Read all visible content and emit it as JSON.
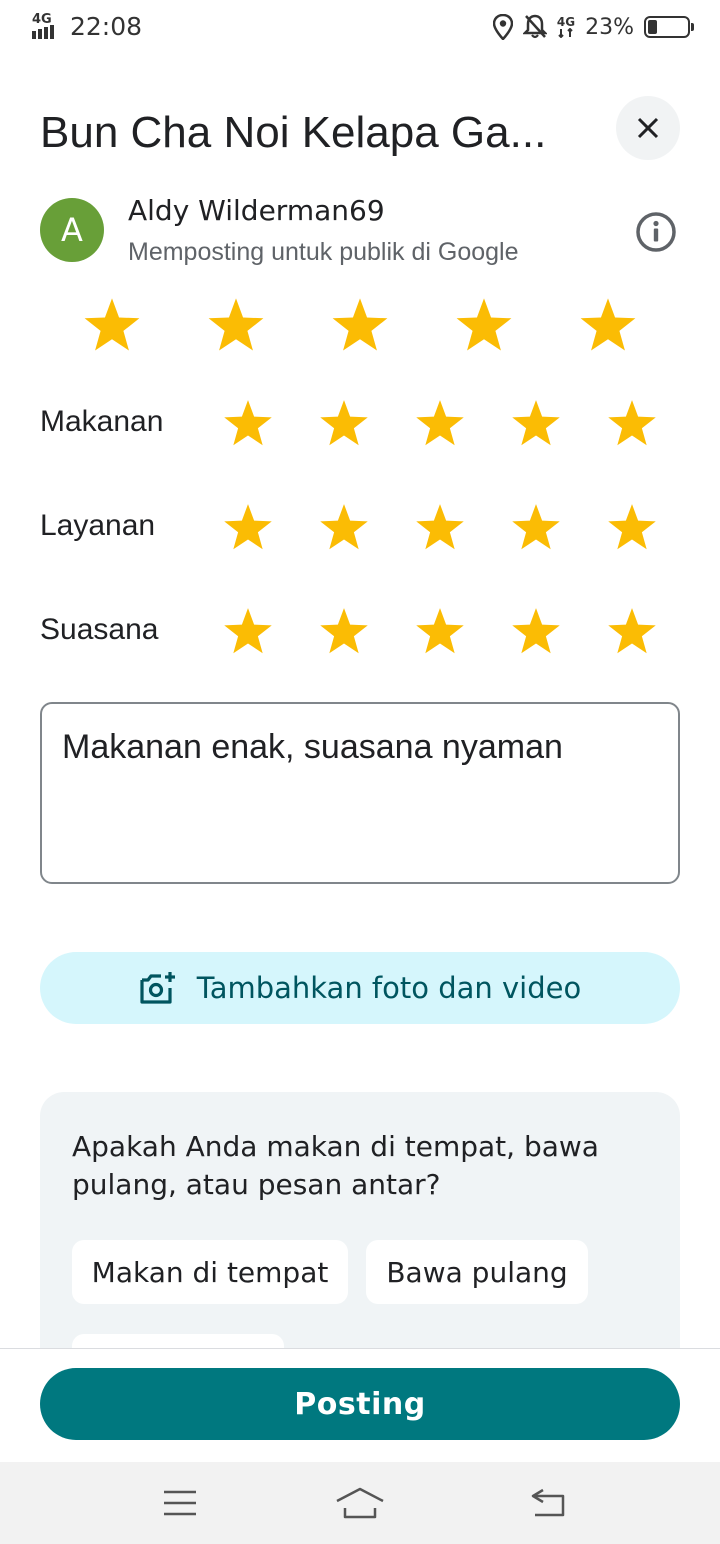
{
  "status_bar": {
    "network": "4G",
    "time": "22:08",
    "network2": "4G",
    "battery_percent": "23%",
    "battery_level": 0.23
  },
  "header": {
    "title": "Bun Cha Noi Kelapa Ga...",
    "close_icon": "close-icon"
  },
  "user": {
    "avatar_letter": "A",
    "avatar_color": "#689f38",
    "name": "Aldy Wilderman69",
    "subtitle": "Memposting untuk publik di Google",
    "info_icon": "info-icon"
  },
  "overall_rating": {
    "value": 5,
    "max": 5
  },
  "categories": [
    {
      "label": "Makanan",
      "value": 5,
      "max": 5
    },
    {
      "label": "Layanan",
      "value": 5,
      "max": 5
    },
    {
      "label": "Suasana",
      "value": 5,
      "max": 5
    }
  ],
  "review": {
    "text": "Makanan enak, suasana nyaman"
  },
  "add_media": {
    "label": "Tambahkan foto dan video",
    "icon": "add-photo-icon"
  },
  "question_card": {
    "question": "Apakah Anda makan di tempat, bawa pulang, atau pesan antar?",
    "options": [
      "Makan di tempat",
      "Bawa pulang"
    ]
  },
  "post_button": {
    "label": "Posting"
  },
  "nav": {
    "menu_icon": "menu-icon",
    "home_icon": "home-icon",
    "back_icon": "back-icon"
  },
  "colors": {
    "star": "#fbbc04",
    "primary": "#00787f",
    "chip_bg": "#d5f6fc",
    "card_bg": "#f0f4f6"
  }
}
